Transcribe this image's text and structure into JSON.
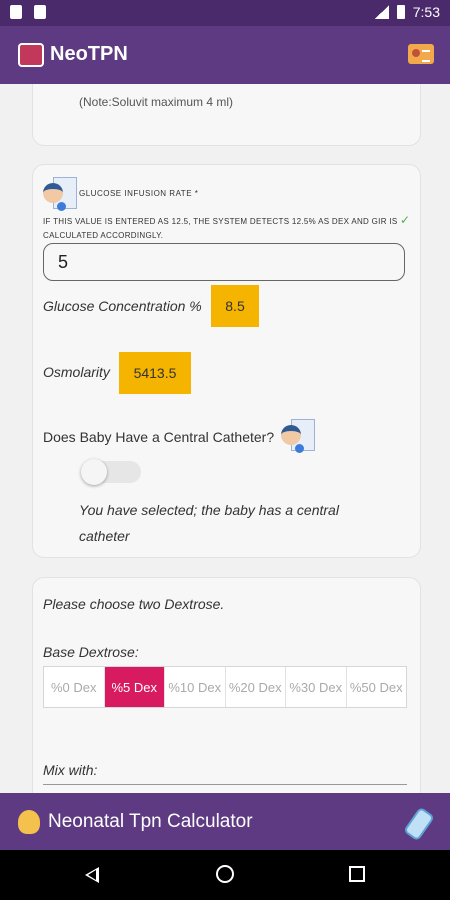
{
  "status_bar": {
    "time": "7:53"
  },
  "app_bar": {
    "title": "NeoTPN"
  },
  "vitamin_card": {
    "note": "(Note:Soluvit maximum 4 ml)"
  },
  "gir_card": {
    "label": "GLUCOSE INFUSION RATE *",
    "help_text": "IF THIS VALUE IS ENTERED AS 12.5, THE SYSTEM DETECTS 12.5% AS DEX AND GIR IS CALCULATED ACCORDINGLY.",
    "gir_value": "5",
    "glucose_concentration_label": "Glucose Concentration %",
    "glucose_concentration_value": "8.5",
    "osmolarity_label": "Osmolarity",
    "osmolarity_value": "5413.5",
    "central_catheter_question": "Does Baby Have a Central Catheter?",
    "selected_text": "You have selected; the baby has a central catheter"
  },
  "dextrose_card": {
    "instruction": "Please choose two Dextrose.",
    "base_label": "Base Dextrose:",
    "options": [
      "%0 Dex",
      "%5 Dex",
      "%10 Dex",
      "%20 Dex",
      "%30 Dex",
      "%50 Dex"
    ],
    "selected_index": 1,
    "mix_label": "Mix with:"
  },
  "bottom_bar": {
    "title": "Neonatal Tpn Calculator"
  },
  "colors": {
    "app_bar": "#5e3a82",
    "status_bar": "#4a2a6b",
    "accent_value": "#f4b400",
    "selected_option": "#d81b60"
  }
}
